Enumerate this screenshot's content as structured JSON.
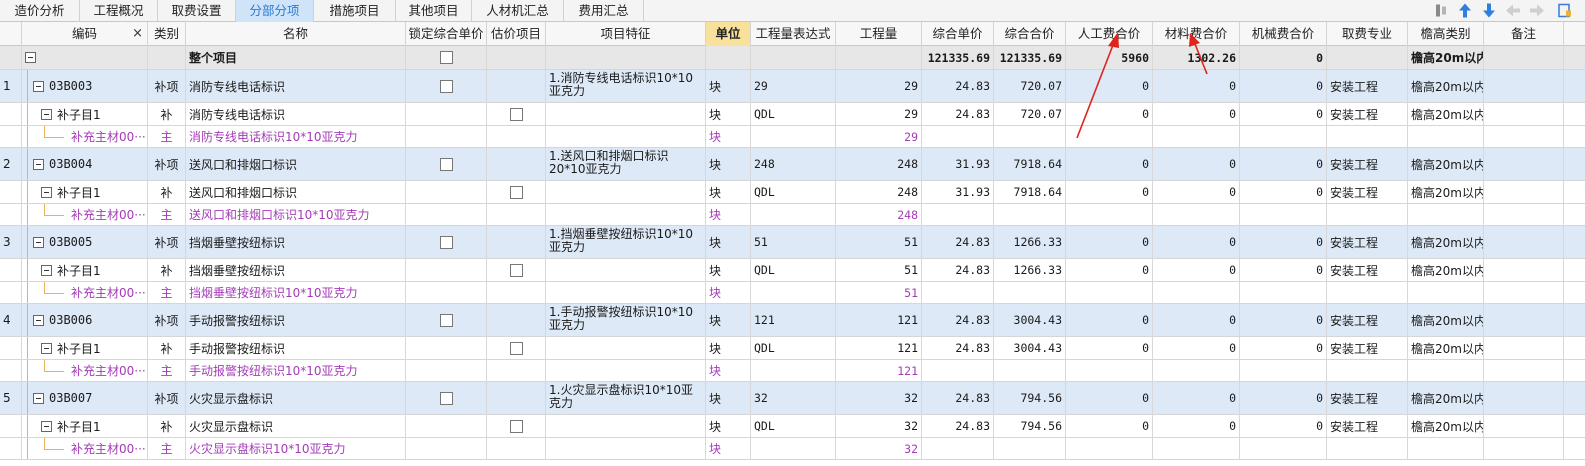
{
  "tabs": [
    {
      "label": "造价分析",
      "active": false
    },
    {
      "label": "工程概况",
      "active": false
    },
    {
      "label": "取费设置",
      "active": false
    },
    {
      "label": "分部分项",
      "active": true
    },
    {
      "label": "措施项目",
      "active": false
    },
    {
      "label": "其他项目",
      "active": false
    },
    {
      "label": "人材机汇总",
      "active": false
    },
    {
      "label": "费用汇总",
      "active": false
    }
  ],
  "toolbar_icons": [
    "insert-icon",
    "move-up-icon",
    "move-down-icon",
    "indent-left-icon",
    "indent-right-icon",
    "more-icon"
  ],
  "columns": {
    "code": "编码",
    "code_clear": "×",
    "type": "类别",
    "name": "名称",
    "lock": "锁定综合单价",
    "est": "估价项目",
    "feature": "项目特征",
    "unit": "单位",
    "expr": "工程量表达式",
    "qty": "工程量",
    "uprice": "综合单价",
    "total": "综合合价",
    "labor": "人工费合价",
    "material": "材料费合价",
    "machine": "机械费合价",
    "specialty": "取费专业",
    "height": "檐高类别",
    "remark": "备注"
  },
  "total_row": {
    "name": "整个项目",
    "total1": "121335.69",
    "total2": "121335.69",
    "labor": "5960",
    "material": "1302.26",
    "machine": "0",
    "height": "檐高20m以内"
  },
  "items": [
    {
      "index": "1",
      "code": "03B003",
      "type": "补项",
      "name": "消防专线电话标识",
      "feature": "1.消防专线电话标识10*10亚克力",
      "unit": "块",
      "expr": "29",
      "qty": "29",
      "uprice": "24.83",
      "total": "720.07",
      "labor": "0",
      "material": "0",
      "machine": "0",
      "specialty": "安装工程",
      "height": "檐高20m以内",
      "sub": {
        "code": "补子目1",
        "type": "补",
        "name": "消防专线电话标识",
        "unit": "块",
        "expr": "QDL",
        "qty": "29",
        "uprice": "24.83",
        "total": "720.07",
        "labor": "0",
        "material": "0",
        "machine": "0",
        "specialty": "安装工程",
        "height": "檐高20m以内"
      },
      "mat": {
        "code": "补充主材00···",
        "type": "主",
        "name": "消防专线电话标识10*10亚克力",
        "unit": "块",
        "qty": "29"
      }
    },
    {
      "index": "2",
      "code": "03B004",
      "type": "补项",
      "name": "送风口和排烟口标识",
      "feature": "1.送风口和排烟口标识20*10亚克力",
      "unit": "块",
      "expr": "248",
      "qty": "248",
      "uprice": "31.93",
      "total": "7918.64",
      "labor": "0",
      "material": "0",
      "machine": "0",
      "specialty": "安装工程",
      "height": "檐高20m以内",
      "sub": {
        "code": "补子目1",
        "type": "补",
        "name": "送风口和排烟口标识",
        "unit": "块",
        "expr": "QDL",
        "qty": "248",
        "uprice": "31.93",
        "total": "7918.64",
        "labor": "0",
        "material": "0",
        "machine": "0",
        "specialty": "安装工程",
        "height": "檐高20m以内"
      },
      "mat": {
        "code": "补充主材00···",
        "type": "主",
        "name": "送风口和排烟口标识10*10亚克力",
        "unit": "块",
        "qty": "248"
      }
    },
    {
      "index": "3",
      "code": "03B005",
      "type": "补项",
      "name": "挡烟垂壁按纽标识",
      "feature": "1.挡烟垂壁按纽标识10*10亚克力",
      "unit": "块",
      "expr": "51",
      "qty": "51",
      "uprice": "24.83",
      "total": "1266.33",
      "labor": "0",
      "material": "0",
      "machine": "0",
      "specialty": "安装工程",
      "height": "檐高20m以内",
      "sub": {
        "code": "补子目1",
        "type": "补",
        "name": "挡烟垂壁按纽标识",
        "unit": "块",
        "expr": "QDL",
        "qty": "51",
        "uprice": "24.83",
        "total": "1266.33",
        "labor": "0",
        "material": "0",
        "machine": "0",
        "specialty": "安装工程",
        "height": "檐高20m以内"
      },
      "mat": {
        "code": "补充主材00···",
        "type": "主",
        "name": "挡烟垂壁按纽标识10*10亚克力",
        "unit": "块",
        "qty": "51"
      }
    },
    {
      "index": "4",
      "code": "03B006",
      "type": "补项",
      "name": "手动报警按纽标识",
      "feature": "1.手动报警按纽标识10*10亚克力",
      "unit": "块",
      "expr": "121",
      "qty": "121",
      "uprice": "24.83",
      "total": "3004.43",
      "labor": "0",
      "material": "0",
      "machine": "0",
      "specialty": "安装工程",
      "height": "檐高20m以内",
      "sub": {
        "code": "补子目1",
        "type": "补",
        "name": "手动报警按纽标识",
        "unit": "块",
        "expr": "QDL",
        "qty": "121",
        "uprice": "24.83",
        "total": "3004.43",
        "labor": "0",
        "material": "0",
        "machine": "0",
        "specialty": "安装工程",
        "height": "檐高20m以内"
      },
      "mat": {
        "code": "补充主材00···",
        "type": "主",
        "name": "手动报警按纽标识10*10亚克力",
        "unit": "块",
        "qty": "121"
      }
    },
    {
      "index": "5",
      "code": "03B007",
      "type": "补项",
      "name": "火灾显示盘标识",
      "feature": "1.火灾显示盘标识10*10亚克力",
      "unit": "块",
      "expr": "32",
      "qty": "32",
      "uprice": "24.83",
      "total": "794.56",
      "labor": "0",
      "material": "0",
      "machine": "0",
      "specialty": "安装工程",
      "height": "檐高20m以内",
      "sub": {
        "code": "补子目1",
        "type": "补",
        "name": "火灾显示盘标识",
        "unit": "块",
        "expr": "QDL",
        "qty": "32",
        "uprice": "24.83",
        "total": "794.56",
        "labor": "0",
        "material": "0",
        "machine": "0",
        "specialty": "安装工程",
        "height": "檐高20m以内"
      },
      "mat": {
        "code": "补充主材00···",
        "type": "主",
        "name": "火灾显示盘标识10*10亚克力",
        "unit": "块",
        "qty": "32"
      }
    }
  ],
  "colors": {
    "accent": "#2c7bd1",
    "unit_header": "#f8e19a",
    "row_blue": "#dde9f6",
    "material_text": "#a53bb8",
    "annotation_arrow": "#e0231c"
  }
}
